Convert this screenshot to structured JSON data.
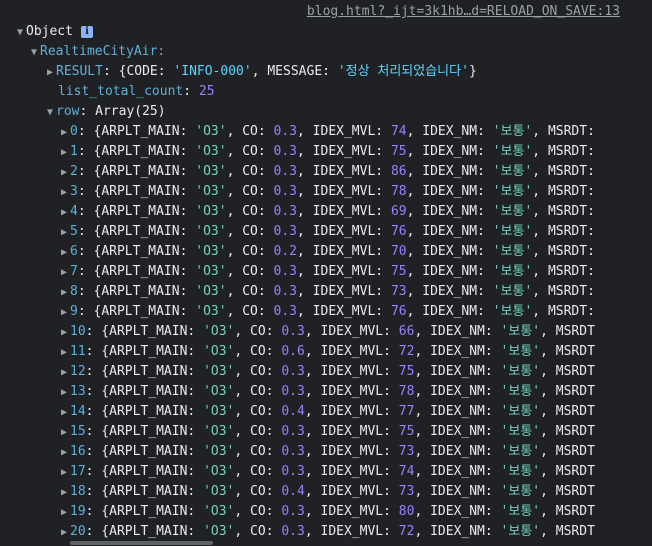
{
  "source_link": "blog.html?_ijt=3k1hb…d=RELOAD_ON_SAVE:13",
  "root_label": "Object",
  "info_badge": "i",
  "city_key": "RealtimeCityAir",
  "result": {
    "key": "RESULT",
    "code_key": "CODE",
    "code": "'INFO-000'",
    "message_key": "MESSAGE",
    "message": "'정상 처리되었습니다'"
  },
  "list_total_count": {
    "key": "list_total_count",
    "value": "25"
  },
  "row": {
    "key": "row",
    "label": "Array(25)"
  },
  "rows": [
    {
      "index": "0",
      "main": "'O3'",
      "co": "0.3",
      "mvl": "74",
      "nm": "'보통'",
      "tail": "MSRDT:"
    },
    {
      "index": "1",
      "main": "'O3'",
      "co": "0.3",
      "mvl": "75",
      "nm": "'보통'",
      "tail": "MSRDT:"
    },
    {
      "index": "2",
      "main": "'O3'",
      "co": "0.3",
      "mvl": "86",
      "nm": "'보통'",
      "tail": "MSRDT:"
    },
    {
      "index": "3",
      "main": "'O3'",
      "co": "0.3",
      "mvl": "78",
      "nm": "'보통'",
      "tail": "MSRDT:"
    },
    {
      "index": "4",
      "main": "'O3'",
      "co": "0.3",
      "mvl": "69",
      "nm": "'보통'",
      "tail": "MSRDT:"
    },
    {
      "index": "5",
      "main": "'O3'",
      "co": "0.3",
      "mvl": "76",
      "nm": "'보통'",
      "tail": "MSRDT:"
    },
    {
      "index": "6",
      "main": "'O3'",
      "co": "0.2",
      "mvl": "70",
      "nm": "'보통'",
      "tail": "MSRDT:"
    },
    {
      "index": "7",
      "main": "'O3'",
      "co": "0.3",
      "mvl": "75",
      "nm": "'보통'",
      "tail": "MSRDT:"
    },
    {
      "index": "8",
      "main": "'O3'",
      "co": "0.3",
      "mvl": "73",
      "nm": "'보통'",
      "tail": "MSRDT:"
    },
    {
      "index": "9",
      "main": "'O3'",
      "co": "0.3",
      "mvl": "76",
      "nm": "'보통'",
      "tail": "MSRDT:"
    },
    {
      "index": "10",
      "main": "'O3'",
      "co": "0.3",
      "mvl": "66",
      "nm": "'보통'",
      "tail": "MSRDT"
    },
    {
      "index": "11",
      "main": "'O3'",
      "co": "0.6",
      "mvl": "72",
      "nm": "'보통'",
      "tail": "MSRDT"
    },
    {
      "index": "12",
      "main": "'O3'",
      "co": "0.3",
      "mvl": "75",
      "nm": "'보통'",
      "tail": "MSRDT"
    },
    {
      "index": "13",
      "main": "'O3'",
      "co": "0.3",
      "mvl": "78",
      "nm": "'보통'",
      "tail": "MSRDT"
    },
    {
      "index": "14",
      "main": "'O3'",
      "co": "0.4",
      "mvl": "77",
      "nm": "'보통'",
      "tail": "MSRDT"
    },
    {
      "index": "15",
      "main": "'O3'",
      "co": "0.3",
      "mvl": "75",
      "nm": "'보통'",
      "tail": "MSRDT"
    },
    {
      "index": "16",
      "main": "'O3'",
      "co": "0.3",
      "mvl": "73",
      "nm": "'보통'",
      "tail": "MSRDT"
    },
    {
      "index": "17",
      "main": "'O3'",
      "co": "0.3",
      "mvl": "74",
      "nm": "'보통'",
      "tail": "MSRDT"
    },
    {
      "index": "18",
      "main": "'O3'",
      "co": "0.4",
      "mvl": "73",
      "nm": "'보통'",
      "tail": "MSRDT"
    },
    {
      "index": "19",
      "main": "'O3'",
      "co": "0.3",
      "mvl": "80",
      "nm": "'보통'",
      "tail": "MSRDT"
    },
    {
      "index": "20",
      "main": "'O3'",
      "co": "0.3",
      "mvl": "72",
      "nm": "'보통'",
      "tail": "MSRDT"
    }
  ],
  "field_names": {
    "main": "ARPLT_MAIN",
    "co": "CO",
    "mvl": "IDEX_MVL",
    "nm": "IDEX_NM"
  },
  "colors": {
    "background": "#202124",
    "key": "#5db0d7",
    "string": "#5cd5fb",
    "number": "#9980ff",
    "triangle": "#9aa0a6"
  },
  "icons": {
    "expanded": "triangle-down-icon",
    "collapsed": "triangle-right-icon"
  }
}
